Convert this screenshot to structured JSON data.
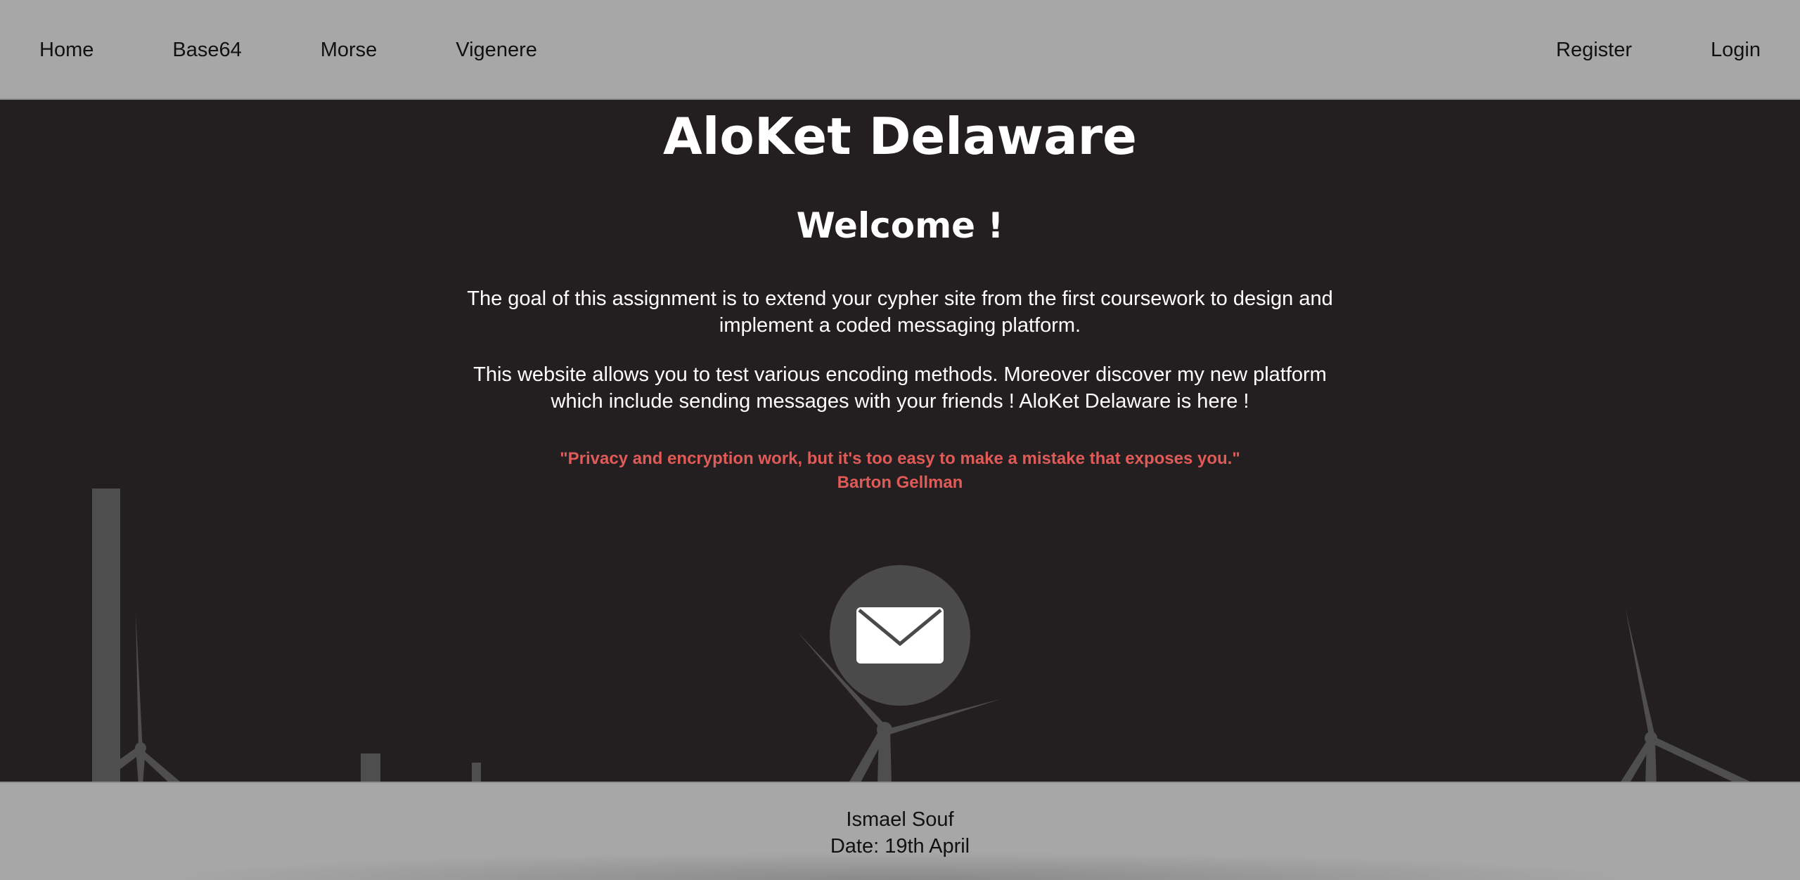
{
  "nav": {
    "left": [
      "Home",
      "Base64",
      "Morse",
      "Vigenere"
    ],
    "right": [
      "Register",
      "Login"
    ]
  },
  "main": {
    "title": "AloKet Delaware",
    "welcome": "Welcome !",
    "paragraphs": [
      "The goal of this assignment is to extend your cypher site from the first coursework to design and implement a coded messaging platform.",
      "This website allows you to test various encoding methods. Moreover discover my new platform which include sending messages with your friends ! AloKet Delaware is here !"
    ],
    "quote": {
      "text": "\"Privacy and encryption work, but it's too easy to make a mistake that exposes you.\"",
      "author": "Barton Gellman"
    },
    "mail_icon": "envelope-icon"
  },
  "footer": {
    "author": "Ismael Souf",
    "date": "Date: 19th April"
  },
  "colors": {
    "nav_bg": "#a7a7a7",
    "main_bg": "#231f20",
    "quote": "#e05a57",
    "silhouette": "#4e4e4e",
    "mail_circle": "#4a4a4a"
  }
}
